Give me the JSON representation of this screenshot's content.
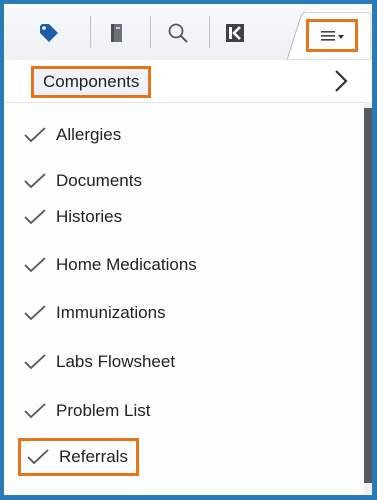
{
  "toolbar": {
    "buttons": [
      {
        "name": "tag-icon"
      },
      {
        "name": "book-icon"
      },
      {
        "name": "search-icon"
      },
      {
        "name": "collapse-left-icon"
      }
    ],
    "menu_icon": "hamburger-menu-icon"
  },
  "header": {
    "label": "Components",
    "chevron_icon": "chevron-right-icon"
  },
  "items": [
    {
      "label": "Allergies",
      "checked": true
    },
    {
      "label": "Documents",
      "checked": true
    },
    {
      "label": "Histories",
      "checked": true
    },
    {
      "label": "Home Medications",
      "checked": true
    },
    {
      "label": "Immunizations",
      "checked": true
    },
    {
      "label": "Labs Flowsheet",
      "checked": true
    },
    {
      "label": "Problem List",
      "checked": true
    },
    {
      "label": "Referrals",
      "checked": true
    }
  ],
  "colors": {
    "highlight": "#e67519",
    "frame": "#2b7ab8",
    "tag_icon": "#1c5ea8"
  }
}
